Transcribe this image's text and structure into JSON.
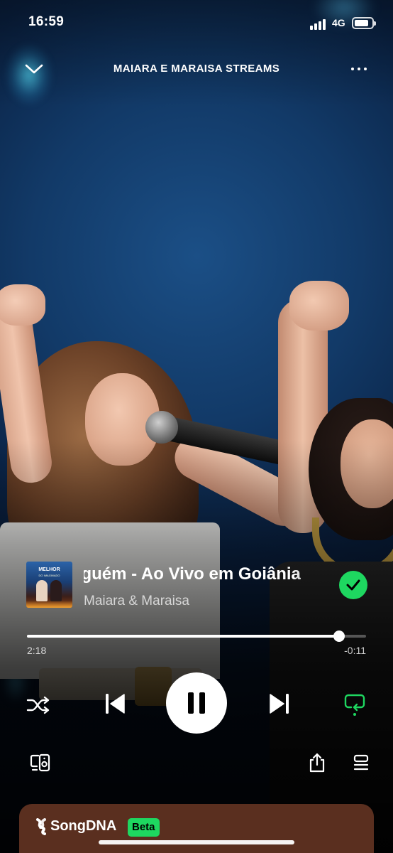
{
  "status_bar": {
    "time": "16:59",
    "network": "4G",
    "signal_icon": "cellular-signal-icon",
    "battery_icon": "battery-icon",
    "battery_level": 0.75
  },
  "header": {
    "title": "MAIARA E MARAISA STREAMS",
    "collapse_icon": "chevron-down-icon",
    "more_icon": "more-horizontal-icon"
  },
  "track": {
    "title": "Parte de Alguém - Ao Vivo em Goiânia",
    "artist": "Maiara & Maraisa",
    "cover": {
      "title": "MELHOR",
      "subtitle": "DO IMAGINADO"
    },
    "liked": true,
    "liked_icon": "check-icon"
  },
  "playback": {
    "elapsed": "2:18",
    "remaining": "-0:11",
    "progress": 0.92,
    "shuffle_icon": "shuffle-icon",
    "previous_icon": "skip-previous-icon",
    "play_pause_icon": "pause-icon",
    "next_icon": "skip-next-icon",
    "repeat_icon": "repeat-icon"
  },
  "footer_actions": {
    "device_icon": "connect-device-icon",
    "share_icon": "share-icon",
    "queue_icon": "queue-icon"
  },
  "songdna": {
    "label": "SongDNA",
    "badge": "Beta",
    "logo_icon": "songdna-icon"
  },
  "colors": {
    "accent": "#1ed760",
    "card": "#5a2f1f"
  }
}
